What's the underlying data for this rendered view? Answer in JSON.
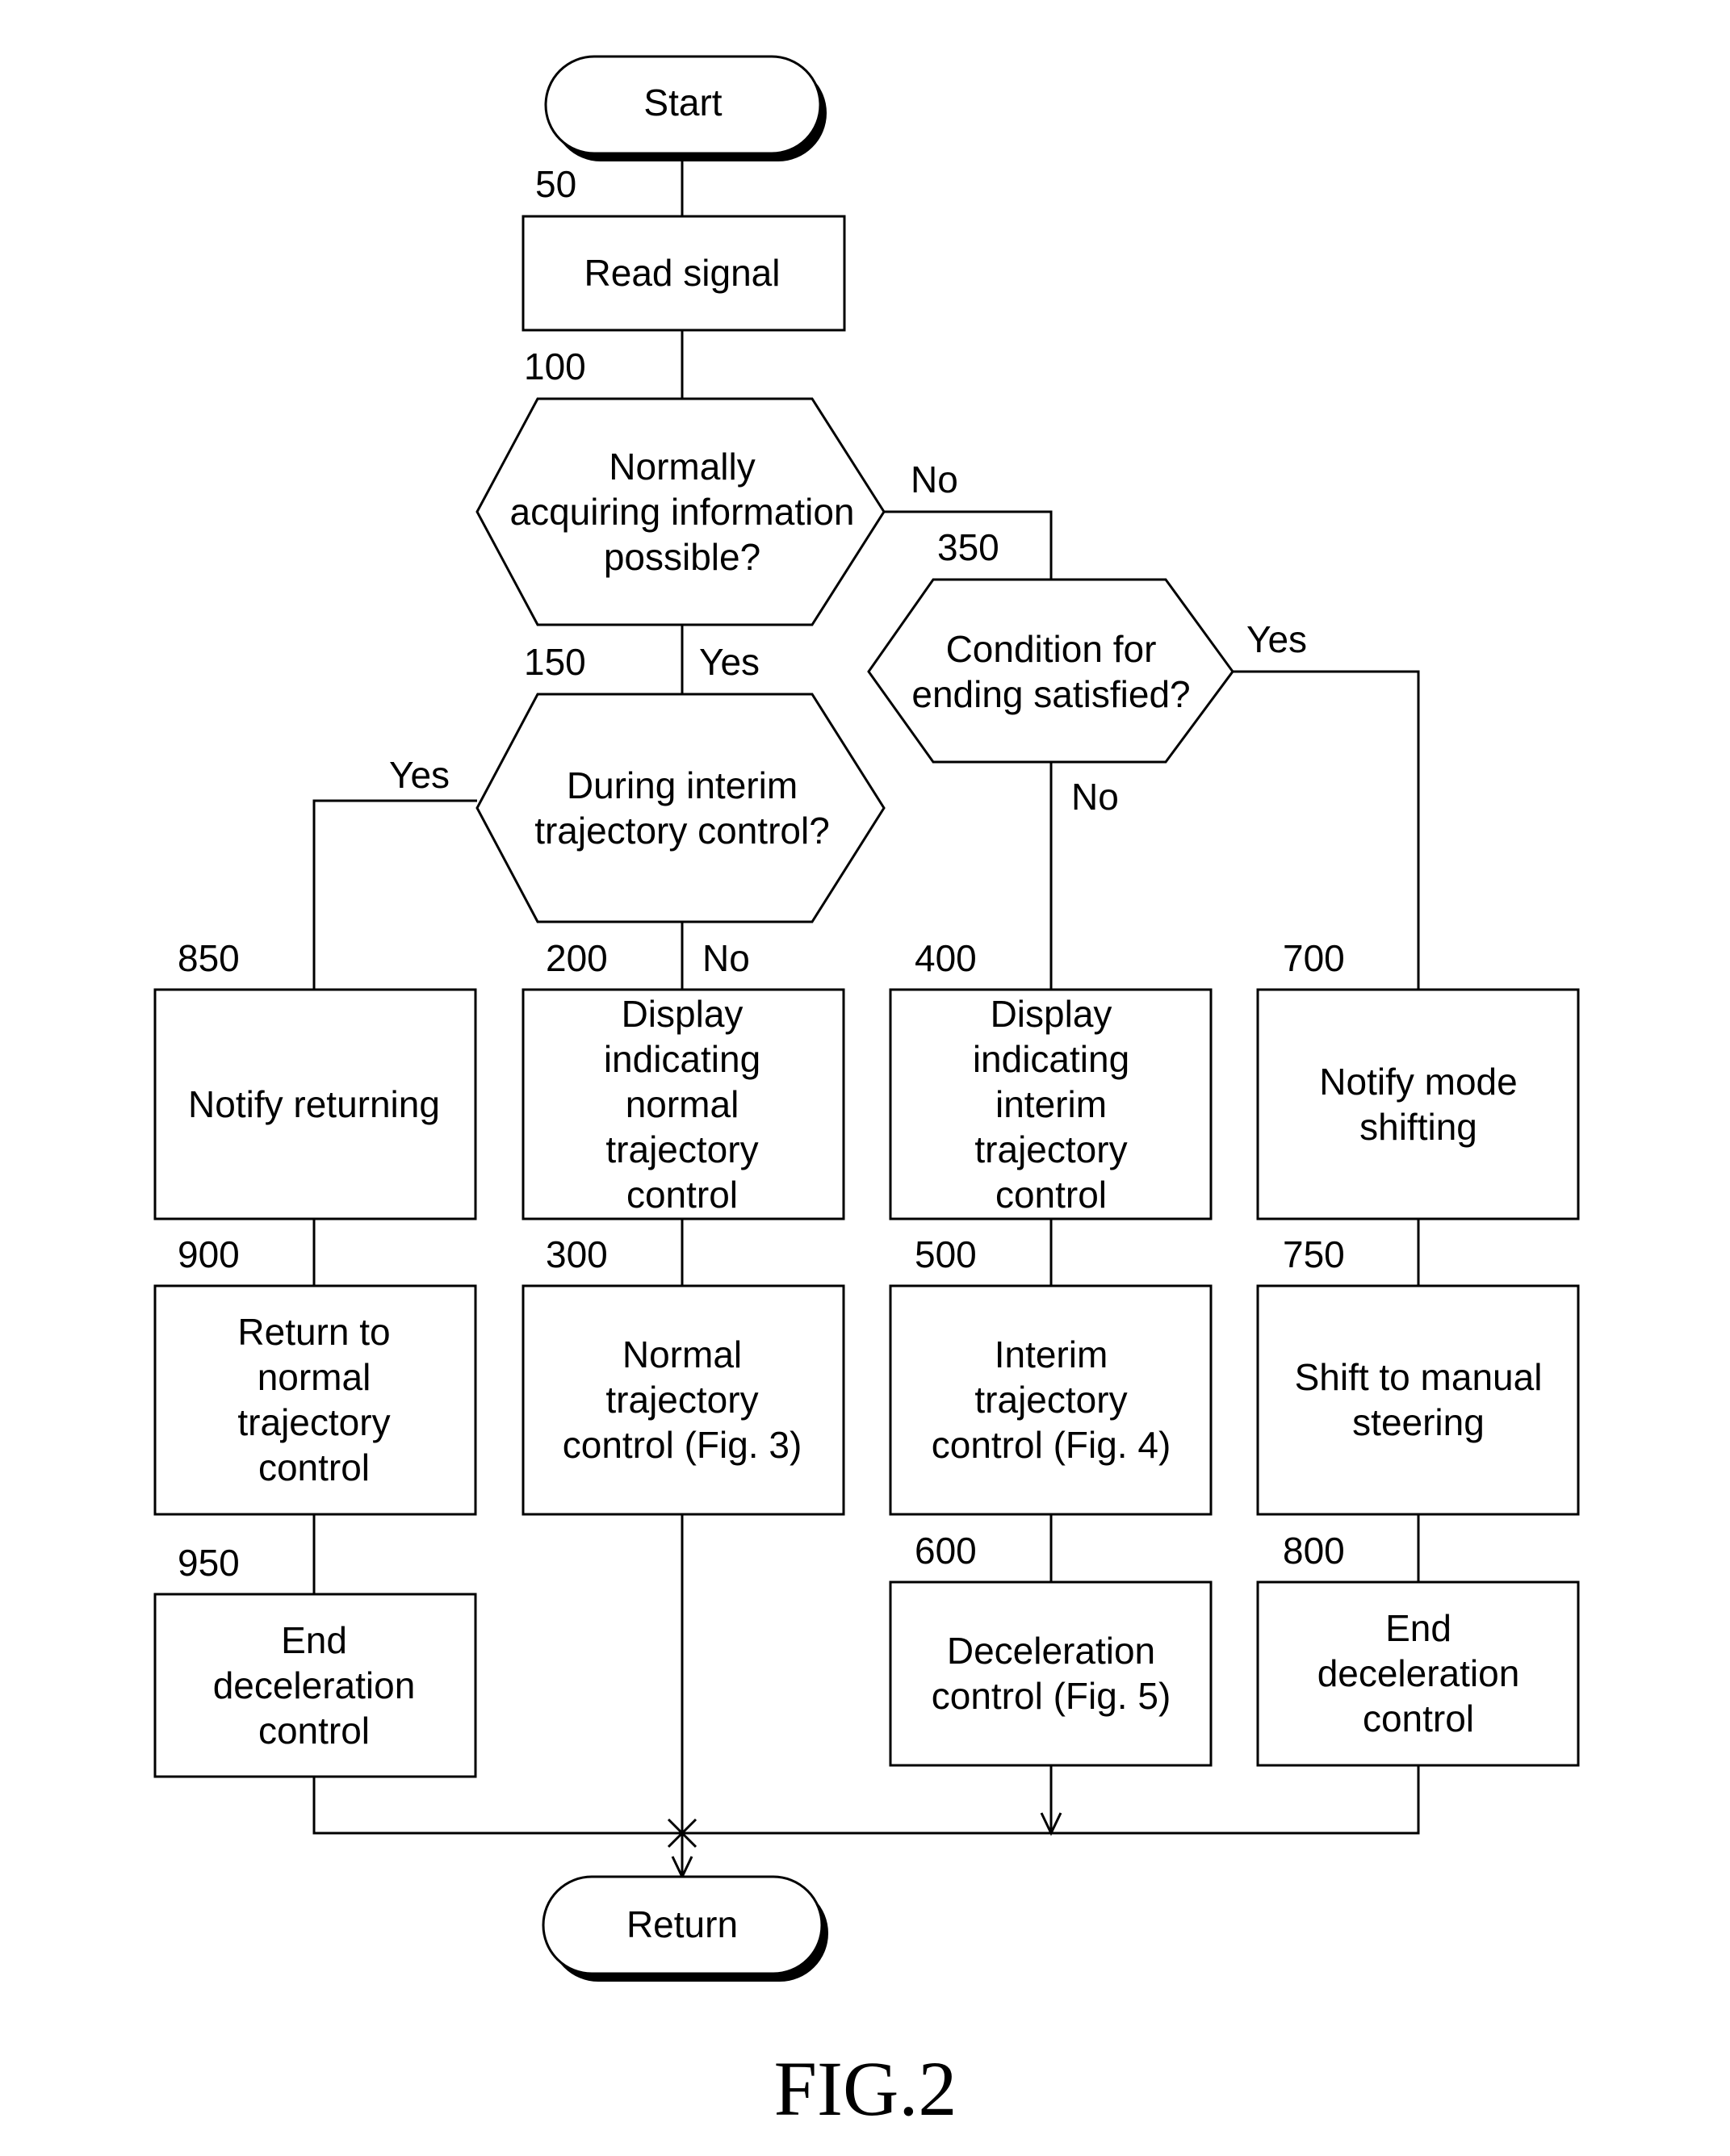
{
  "figure_label": "FIG.2",
  "terminals": {
    "start": "Start",
    "return": "Return"
  },
  "steps": {
    "s50": {
      "num": "50",
      "lines": [
        "Read signal"
      ]
    },
    "s100": {
      "num": "100",
      "lines": [
        "Normally",
        "acquiring information",
        "possible?"
      ]
    },
    "s150": {
      "num": "150",
      "lines": [
        "During interim",
        "trajectory control?"
      ]
    },
    "s350": {
      "num": "350",
      "lines": [
        "Condition for",
        "ending satisfied?"
      ]
    },
    "s200": {
      "num": "200",
      "lines": [
        "Display",
        "indicating",
        "normal",
        "trajectory",
        "control"
      ]
    },
    "s300": {
      "num": "300",
      "lines": [
        "Normal",
        "trajectory",
        "control (Fig. 3)"
      ]
    },
    "s400": {
      "num": "400",
      "lines": [
        "Display",
        "indicating",
        "interim",
        "trajectory",
        "control"
      ]
    },
    "s500": {
      "num": "500",
      "lines": [
        "Interim",
        "trajectory",
        "control (Fig. 4)"
      ]
    },
    "s600": {
      "num": "600",
      "lines": [
        "Deceleration",
        "control (Fig. 5)"
      ]
    },
    "s700": {
      "num": "700",
      "lines": [
        "Notify mode",
        "shifting"
      ]
    },
    "s750": {
      "num": "750",
      "lines": [
        "Shift to manual",
        "steering"
      ]
    },
    "s800": {
      "num": "800",
      "lines": [
        "End",
        "deceleration",
        "control"
      ]
    },
    "s850": {
      "num": "850",
      "lines": [
        "Notify returning"
      ]
    },
    "s900": {
      "num": "900",
      "lines": [
        "Return to",
        "normal",
        "trajectory",
        "control"
      ]
    },
    "s950": {
      "num": "950",
      "lines": [
        "End",
        "deceleration",
        "control"
      ]
    }
  },
  "branch_labels": {
    "s100_no": "No",
    "s100_yes": "Yes",
    "s150_yes": "Yes",
    "s150_no": "No",
    "s350_yes": "Yes",
    "s350_no": "No"
  }
}
